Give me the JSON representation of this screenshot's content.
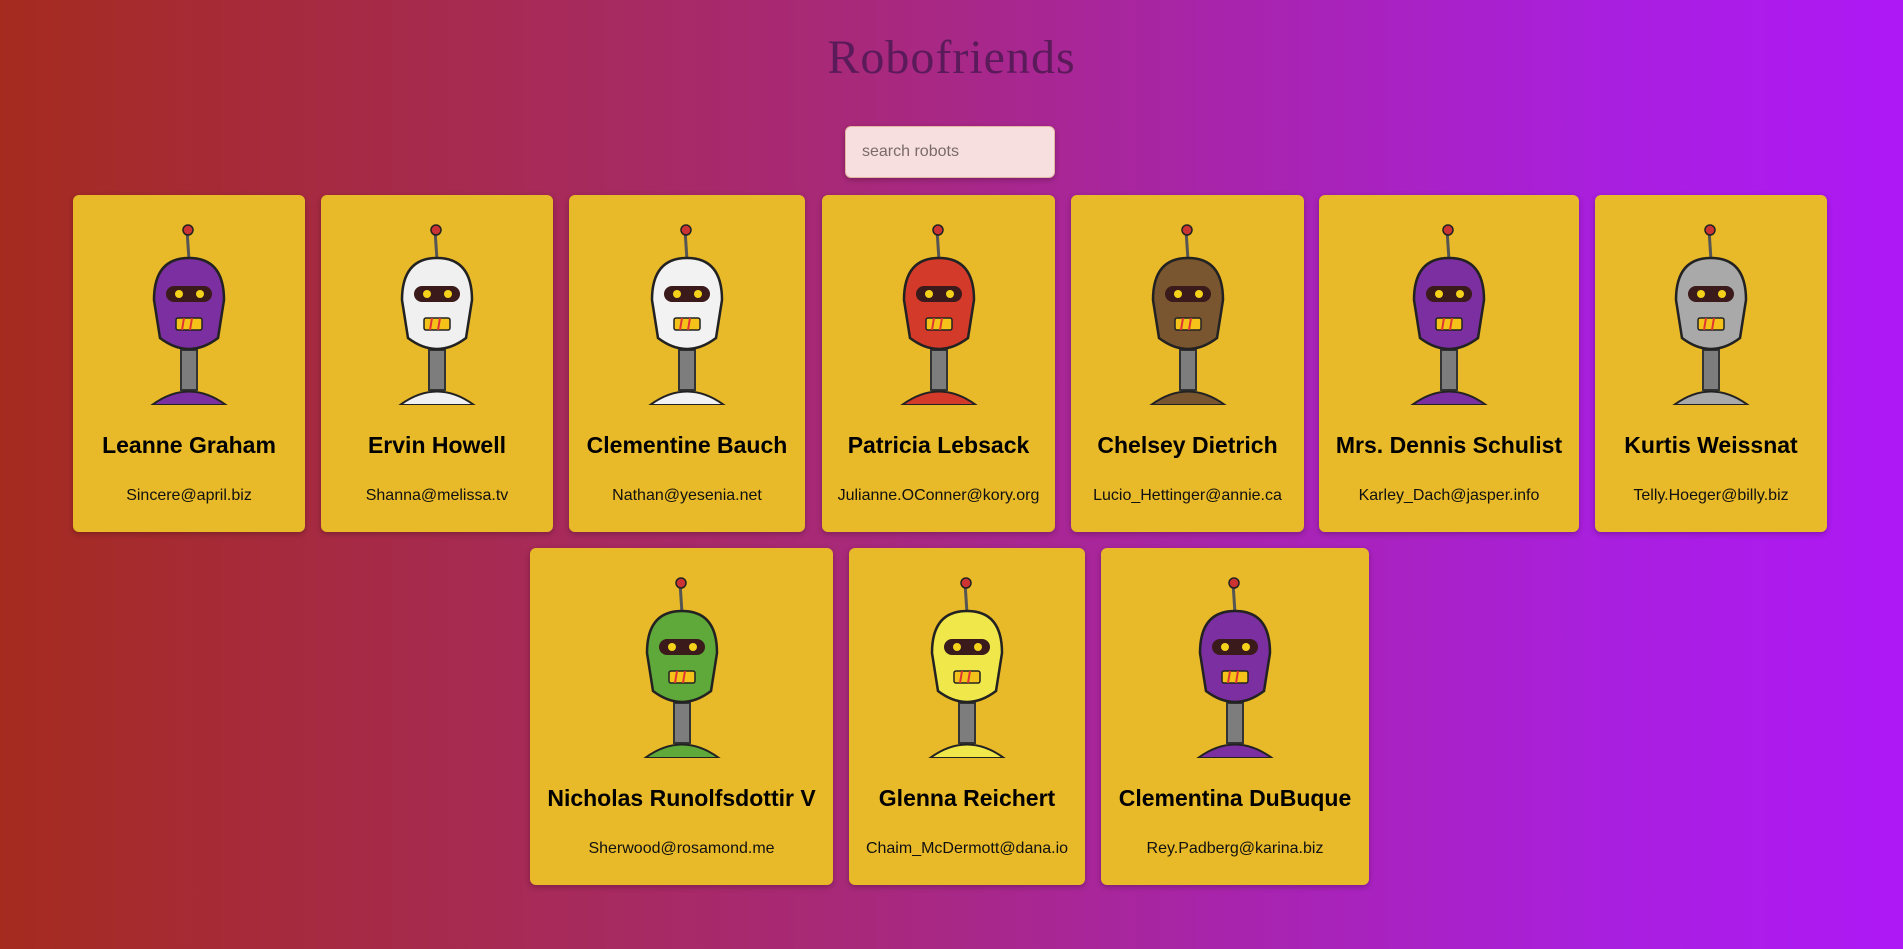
{
  "app": {
    "title": "Robofriends"
  },
  "search": {
    "placeholder": "search robots",
    "value": ""
  },
  "robots": [
    {
      "name": "Leanne Graham",
      "email": "Sincere@april.biz",
      "color": "#7b2fa0"
    },
    {
      "name": "Ervin Howell",
      "email": "Shanna@melissa.tv",
      "color": "#f0f0f0"
    },
    {
      "name": "Clementine Bauch",
      "email": "Nathan@yesenia.net",
      "color": "#f2f2f2"
    },
    {
      "name": "Patricia Lebsack",
      "email": "Julianne.OConner@kory.org",
      "color": "#d43a2a"
    },
    {
      "name": "Chelsey Dietrich",
      "email": "Lucio_Hettinger@annie.ca",
      "color": "#7a5630"
    },
    {
      "name": "Mrs. Dennis Schulist",
      "email": "Karley_Dach@jasper.info",
      "color": "#7b2fa0"
    },
    {
      "name": "Kurtis Weissnat",
      "email": "Telly.Hoeger@billy.biz",
      "color": "#a9a9a9"
    },
    {
      "name": "Nicholas Runolfsdottir V",
      "email": "Sherwood@rosamond.me",
      "color": "#5fa83a"
    },
    {
      "name": "Glenna Reichert",
      "email": "Chaim_McDermott@dana.io",
      "color": "#f0e84a"
    },
    {
      "name": "Clementina DuBuque",
      "email": "Rey.Padberg@karina.biz",
      "color": "#7b2fa0"
    }
  ]
}
